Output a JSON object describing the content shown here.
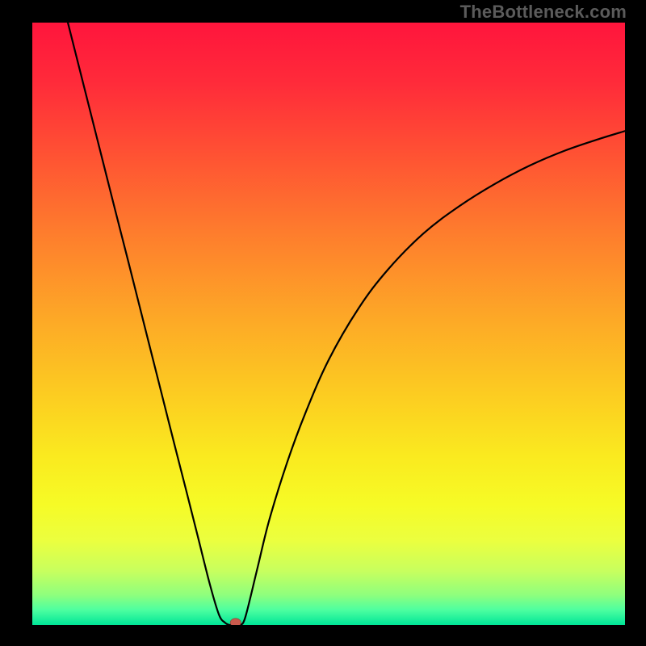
{
  "watermark": "TheBottleneck.com",
  "colors": {
    "gradient_stops": [
      {
        "offset": 0.0,
        "color": "#ff153c"
      },
      {
        "offset": 0.1,
        "color": "#ff2b3a"
      },
      {
        "offset": 0.22,
        "color": "#ff5233"
      },
      {
        "offset": 0.35,
        "color": "#fe7d2d"
      },
      {
        "offset": 0.5,
        "color": "#fdab26"
      },
      {
        "offset": 0.62,
        "color": "#fccd21"
      },
      {
        "offset": 0.72,
        "color": "#faea1f"
      },
      {
        "offset": 0.8,
        "color": "#f6fb26"
      },
      {
        "offset": 0.86,
        "color": "#ebff3f"
      },
      {
        "offset": 0.91,
        "color": "#c8ff5e"
      },
      {
        "offset": 0.95,
        "color": "#8fff7d"
      },
      {
        "offset": 0.975,
        "color": "#4dffa0"
      },
      {
        "offset": 1.0,
        "color": "#00e597"
      }
    ],
    "curve": "#000000",
    "marker_fill": "#c95a4d",
    "marker_stroke": "#8a3b33",
    "frame": "#000000"
  },
  "chart_data": {
    "type": "line",
    "title": "",
    "xlabel": "",
    "ylabel": "",
    "xlim": [
      0,
      100
    ],
    "ylim": [
      0,
      100
    ],
    "grid": false,
    "series": [
      {
        "name": "left-branch",
        "x": [
          6,
          8,
          10,
          12,
          14,
          16,
          18,
          20,
          22,
          24,
          26,
          28,
          30,
          31.5,
          32.5,
          33.2
        ],
        "y": [
          100,
          92.2,
          84.4,
          76.6,
          68.8,
          61.1,
          53.3,
          45.5,
          37.7,
          29.9,
          22.2,
          14.4,
          6.6,
          1.7,
          0.4,
          0.0
        ]
      },
      {
        "name": "notch-flat",
        "x": [
          33.2,
          35.2
        ],
        "y": [
          0.0,
          0.0
        ]
      },
      {
        "name": "right-branch",
        "x": [
          35.2,
          36,
          38,
          40,
          43,
          46,
          50,
          55,
          60,
          66,
          72,
          78,
          84,
          90,
          96,
          100
        ],
        "y": [
          0.0,
          1.5,
          9.5,
          17.5,
          27.0,
          35.0,
          44.0,
          52.5,
          59.0,
          65.0,
          69.5,
          73.2,
          76.3,
          78.8,
          80.8,
          82.0
        ]
      }
    ],
    "marker": {
      "x": 34.3,
      "y": 0.0,
      "rx": 0.9,
      "ry": 0.7
    }
  }
}
